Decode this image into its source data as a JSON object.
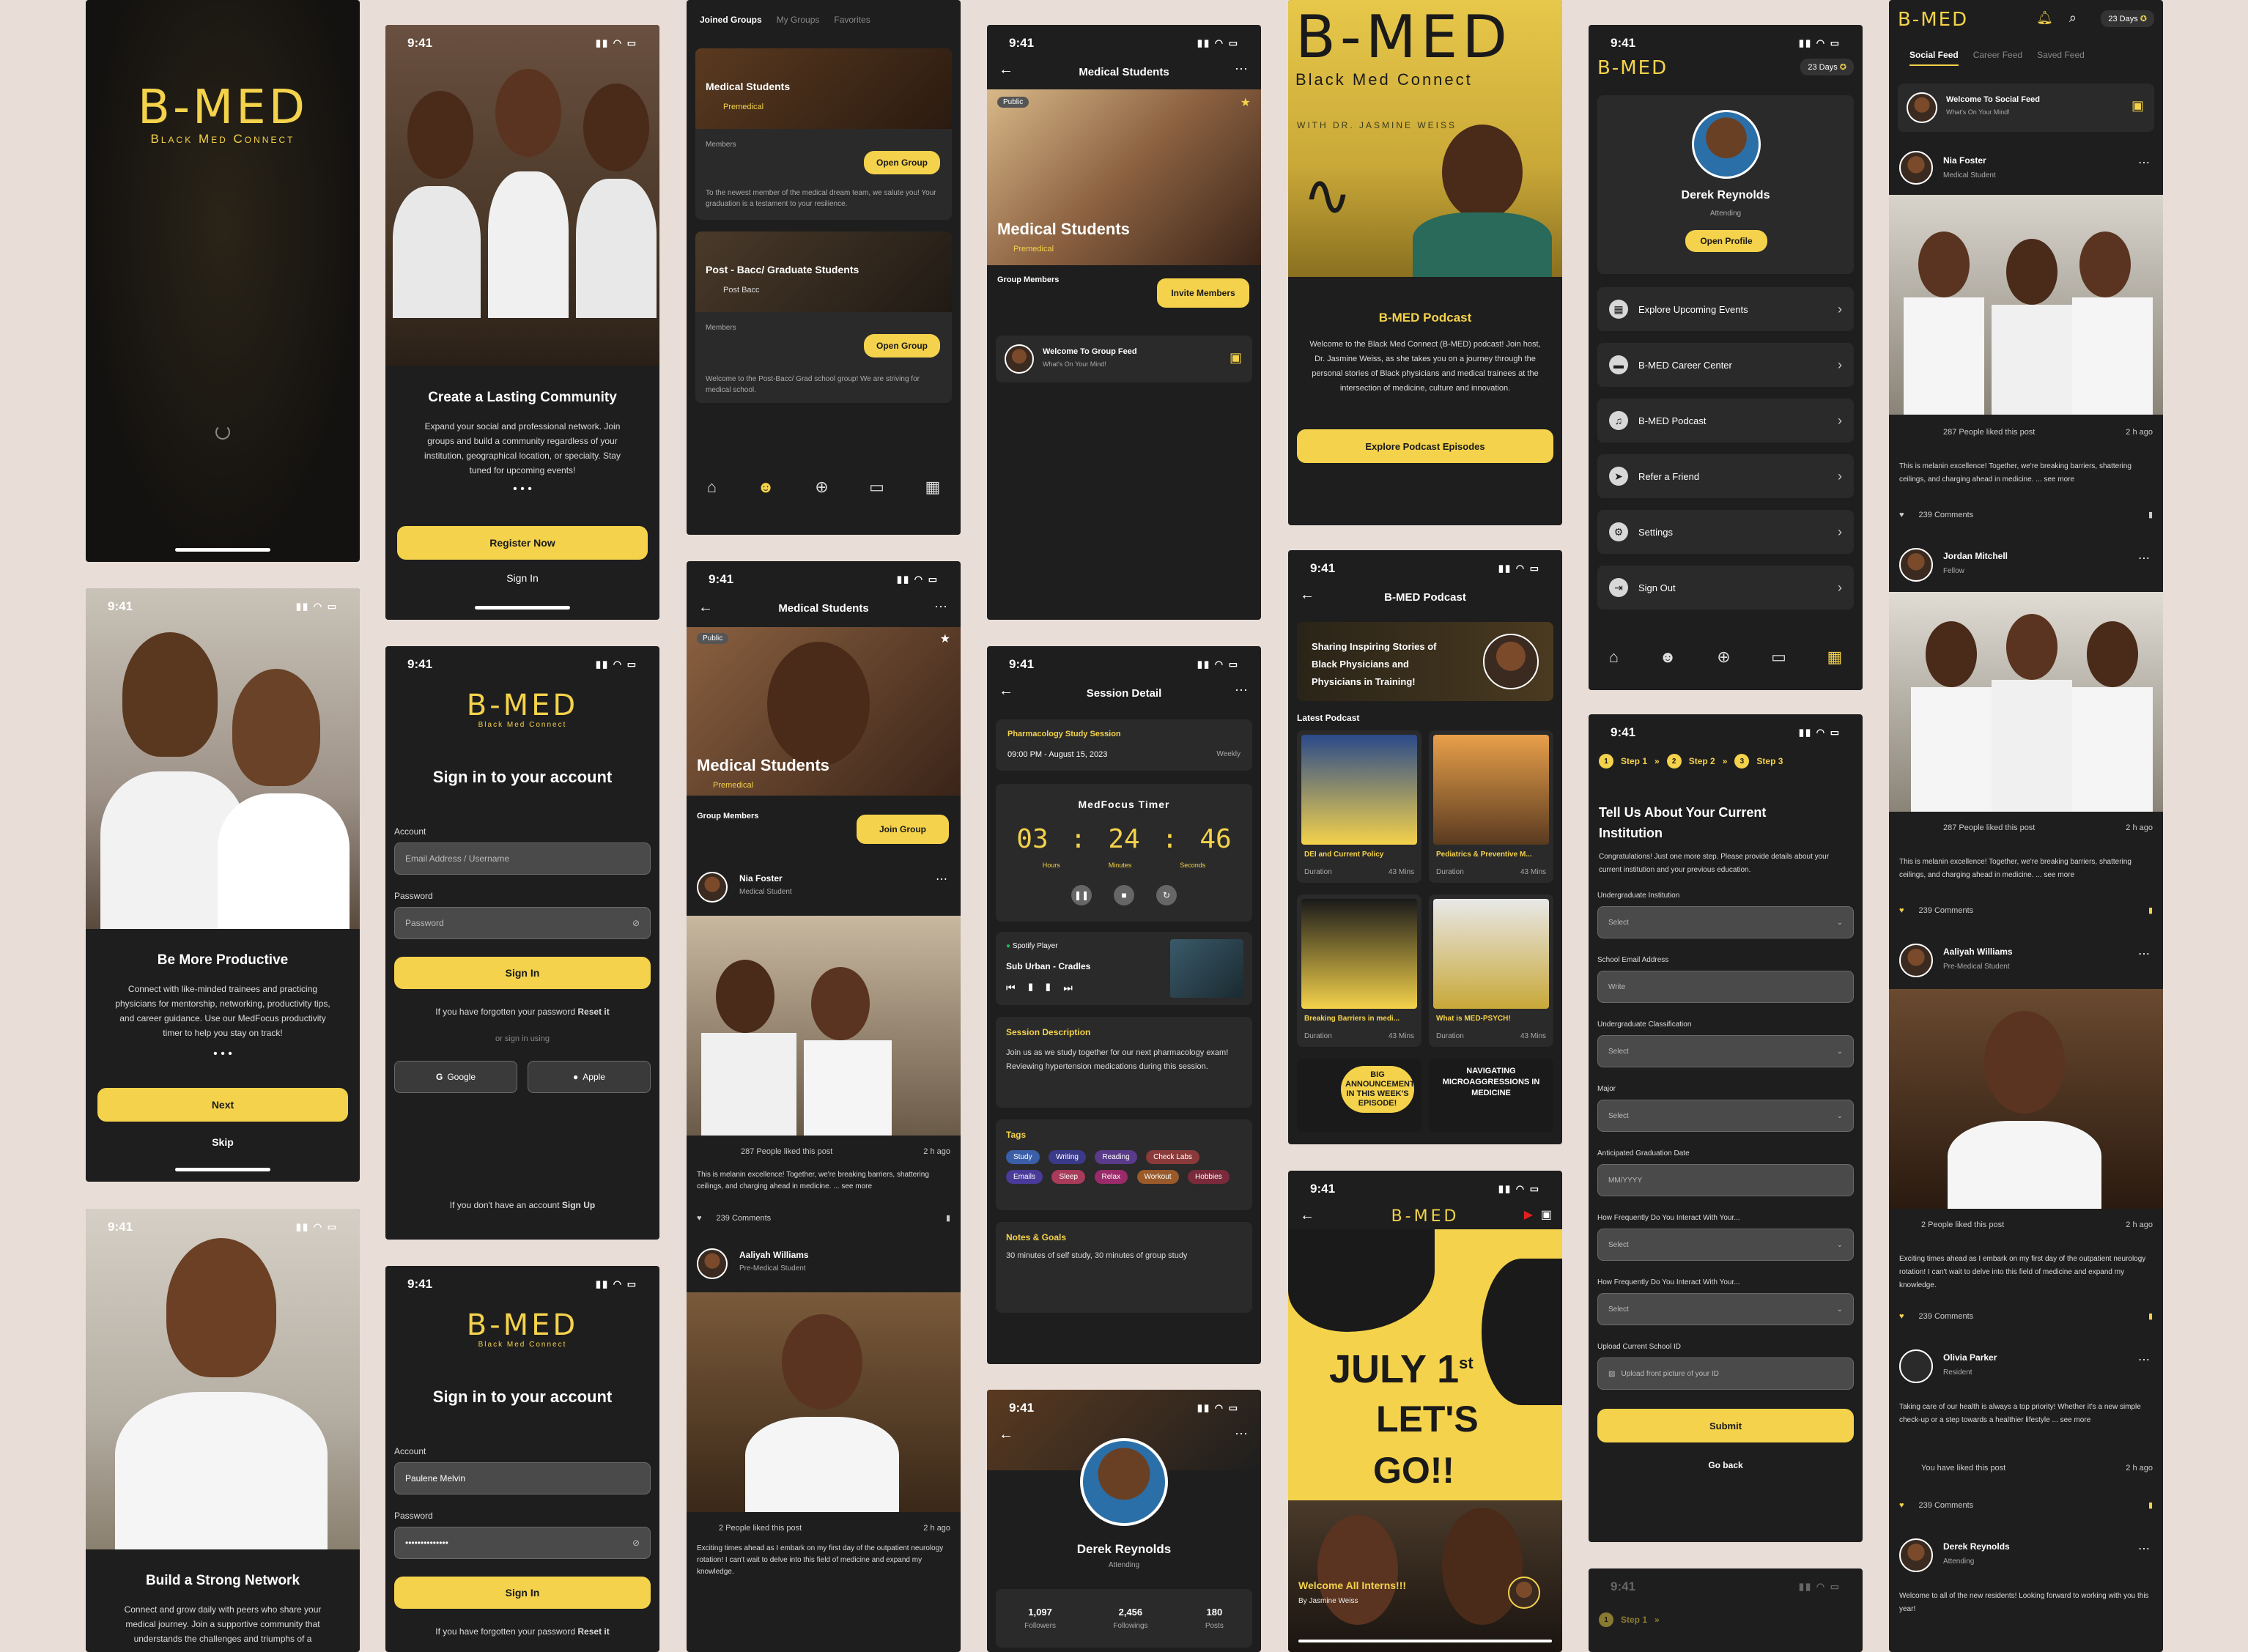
{
  "status_time": "9:41",
  "brand": {
    "logo": "B-MED",
    "tagline": "Black Med Connect"
  },
  "onboard1": {
    "title": "Create a Lasting Community",
    "body": "Expand your social and professional network. Join groups and build a community regardless of your institution, geographical location, or specialty. Stay tuned for upcoming events!",
    "register": "Register Now",
    "signin": "Sign In"
  },
  "onboard2": {
    "title": "Be More Productive",
    "body": "Connect with like-minded trainees and practicing physicians for mentorship, networking, productivity tips, and career guidance. Use our MedFocus productivity timer to help you stay on track!",
    "next": "Next",
    "skip": "Skip"
  },
  "onboard3": {
    "title": "Build a Strong Network",
    "body": "Connect and grow daily with peers who share your medical journey. Join a supportive community that understands the challenges and triumphs of a"
  },
  "signin": {
    "title": "Sign in to your account",
    "account_label": "Account",
    "account_placeholder": "Email Address / Username",
    "password_label": "Password",
    "password_placeholder": "Password",
    "button": "Sign In",
    "forgot": "If you have forgotten your password",
    "reset": "Reset it",
    "or": "or sign in using",
    "google": "Google",
    "apple": "Apple",
    "no_account": "If you don't have an account",
    "signup": "Sign Up"
  },
  "signin2": {
    "account_value": "Paulene Melvin",
    "password_value": "••••••••••••••"
  },
  "groups": {
    "tabs": [
      "Joined Groups",
      "My Groups",
      "Favorites"
    ],
    "items": [
      {
        "name": "Medical Students",
        "sub": "Premedical",
        "members": "Members",
        "button": "Open Group",
        "desc": "To the newest member of  the medical dream team, we salute you! Your graduation is a testament to your resilience."
      },
      {
        "name": "Post - Bacc/ Graduate Students",
        "sub": "Post Bacc",
        "members": "Members",
        "button": "Open Group",
        "desc": "Welcome to the Post-Bacc/ Grad school group! We are striving for medical school."
      }
    ]
  },
  "group_detail": {
    "header": "Medical Students",
    "public": "Public",
    "title": "Medical Students",
    "sub": "Premedical",
    "members_label": "Group Members",
    "join": "Join Group",
    "invite": "Invite Members",
    "welcome": "Welcome To Group Feed",
    "whats": "What's On Your Mind!"
  },
  "posts": [
    {
      "name": "Nia Foster",
      "role": "Medical Student",
      "likes": "287 People liked this post",
      "time": "2 h ago",
      "text": "This is melanin excellence! Together, we're breaking barriers, shattering ceilings, and charging ahead in medicine.",
      "more": "... see more",
      "comments": "239 Comments"
    },
    {
      "name": "Jordan Mitchell",
      "role": "Fellow",
      "likes": "287 People liked this post",
      "time": "2 h ago",
      "text": "This is melanin excellence! Together, we're breaking barriers, shattering ceilings, and charging ahead in medicine.",
      "more": "... see more",
      "comments": "239 Comments"
    },
    {
      "name": "Aaliyah Williams",
      "role": "Pre-Medical Student",
      "likes": "2 People liked this post",
      "time": "2 h ago",
      "text": "Exciting times ahead as I embark on my first day of the outpatient neurology rotation! I can't wait to delve into this field of medicine and expand my knowledge.",
      "comments": "239 Comments"
    },
    {
      "name": "Olivia Parker",
      "role": "Resident",
      "likes": "You have liked this post",
      "time": "2 h ago",
      "text": "Taking care of our health is always a top priority! Whether it's a new simple check-up or a step towards a healthier lifestyle",
      "more": "... see more",
      "comments": "239 Comments"
    },
    {
      "name": "Derek Reynolds",
      "role": "Attending",
      "text": "Welcome to all of the new residents! Looking forward to working with you this year!"
    }
  ],
  "session": {
    "header": "Session Detail",
    "name": "Pharmacology Study Session",
    "date": "09:00 PM - August 15, 2023",
    "freq": "Weekly",
    "timer_title": "MedFocus Timer",
    "hours": "03",
    "minutes": "24",
    "seconds": "46",
    "h_lbl": "Hours",
    "m_lbl": "Minutes",
    "s_lbl": "Seconds",
    "spotify": "Spotify Player",
    "track": "Sub Urban - Cradles",
    "desc_title": "Session Description",
    "desc": "Join us as we study together for our next pharmacology exam! Reviewing hypertension medications during this session.",
    "tags_title": "Tags",
    "tags": [
      "Study",
      "Writing",
      "Reading",
      "Check Labs",
      "Emails",
      "Sleep",
      "Relax",
      "Workout",
      "Hobbies"
    ],
    "notes_title": "Notes & Goals",
    "notes": "30 minutes of self study, 30 minutes of group study"
  },
  "profile": {
    "name": "Derek Reynolds",
    "role": "Attending",
    "followers": "1,097",
    "followers_lbl": "Followers",
    "following": "2,456",
    "following_lbl": "Followings",
    "posts": "180",
    "posts_lbl": "Posts"
  },
  "podcast": {
    "with": "WITH DR. JASMINE WEISS",
    "title": "B-MED Podcast",
    "body": "Welcome to the Black Med Connect (B-MED) podcast! Join host, Dr. Jasmine Weiss, as she takes you on a journey through the personal stories of Black physicians and medical trainees at the intersection of medicine, culture and innovation.",
    "button": "Explore Podcast Episodes"
  },
  "podcast_list": {
    "header": "B-MED Podcast",
    "banner": "Sharing Inspiring Stories of Black Physicians and Physicians in Training!",
    "latest": "Latest Podcast",
    "episodes": [
      {
        "title": "DEI and Current Policy",
        "duration": "Duration",
        "mins": "43 Mins"
      },
      {
        "title": "Pediatrics & Preventive M...",
        "duration": "Duration",
        "mins": "43 Mins"
      },
      {
        "title": "Breaking Barriers in medi...",
        "duration": "Duration",
        "mins": "43 Mins"
      },
      {
        "title": "What is MED-PSYCH!",
        "duration": "Duration",
        "mins": "43 Mins"
      }
    ],
    "ep5": "BIG ANNOUNCEMENT IN THIS WEEK'S EPISODE!",
    "ep6": "NAVIGATING MICROAGGRESSIONS IN MEDICINE"
  },
  "video": {
    "title": "B-MED",
    "headline1": "JULY 1",
    "sup": "st",
    "headline2": "LET'S",
    "headline3": "GO!!",
    "caption": "Welcome All Interns!!!",
    "by": "By Jasmine Weiss"
  },
  "menu": {
    "days": "23 Days",
    "name": "Derek Reynolds",
    "role": "Attending",
    "open": "Open Profile",
    "items": [
      "Explore Upcoming Events",
      "B-MED Career Center",
      "B-MED Podcast",
      "Refer a Friend",
      "Settings",
      "Sign Out"
    ]
  },
  "institution": {
    "steps": [
      "Step 1",
      "Step 2",
      "Step 3"
    ],
    "title": "Tell Us About Your Current Institution",
    "body": "Congratulations! Just one more step. Please provide details about your current institution and your previous education.",
    "fields": [
      {
        "label": "Undergraduate Institution",
        "value": "Select"
      },
      {
        "label": "School Email Address",
        "value": "Write"
      },
      {
        "label": "Undergraduate Classification",
        "value": "Select"
      },
      {
        "label": "Major",
        "value": "Select"
      },
      {
        "label": "Anticipated Graduation Date",
        "value": "MM/YYYY"
      },
      {
        "label": "How Frequently Do You Interact With Your...",
        "value": "Select"
      },
      {
        "label": "How Frequently Do You Interact With Your...",
        "value": "Select"
      },
      {
        "label": "Upload Current School ID",
        "value": "Upload front picture of your ID"
      }
    ],
    "submit": "Submit",
    "back": "Go back"
  },
  "feed": {
    "days": "23 Days",
    "tabs": [
      "Social Feed",
      "Career Feed",
      "Saved Feed"
    ],
    "welcome": "Welcome To Social Feed",
    "whats": "What's On Your Mind!"
  },
  "colors": {
    "accent": "#f4d24b",
    "bg": "#1e1e1e",
    "card": "#2a2a2a"
  }
}
